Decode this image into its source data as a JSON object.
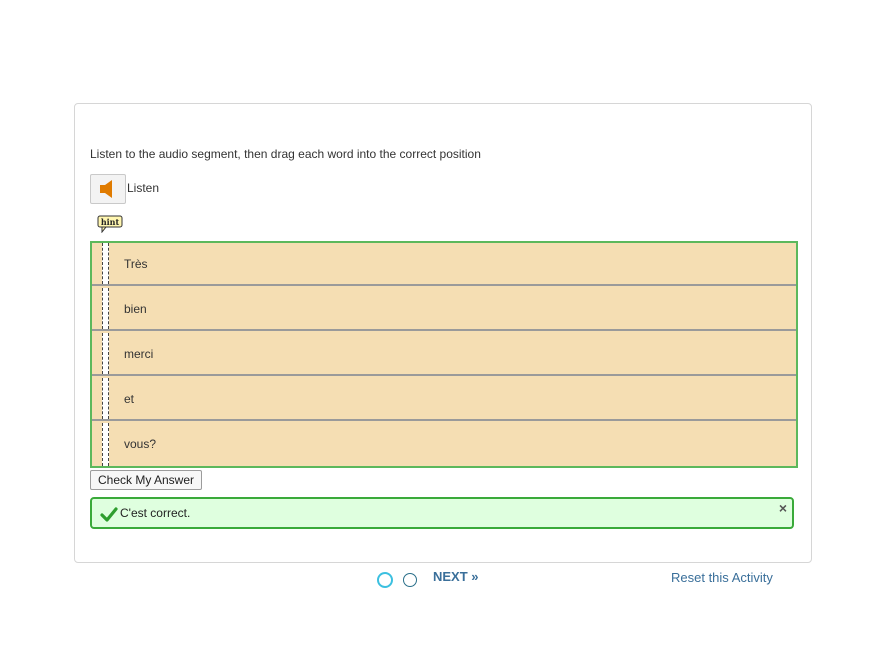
{
  "instruction": "Listen to the audio segment, then drag each word into the correct position",
  "listen": {
    "label": "Listen",
    "icon": "speaker-icon"
  },
  "hint": {
    "label": "hint",
    "icon": "hint-icon"
  },
  "words": [
    "Très",
    "bien",
    "merci",
    "et",
    "vous?"
  ],
  "check_button": "Check My Answer",
  "feedback": {
    "message": "C'est correct.",
    "close": "×",
    "icon": "checkmark-icon"
  },
  "pagination": {
    "total": 2,
    "current": 1
  },
  "next_label": "NEXT »",
  "reset_label": "Reset this Activity",
  "colors": {
    "row_bg": "#f5deb3",
    "list_border": "#5cb85c",
    "feedback_bg": "#dfffdf",
    "feedback_border": "#3aaa3a",
    "link": "#3a6f9a",
    "speaker": "#e07b00"
  }
}
